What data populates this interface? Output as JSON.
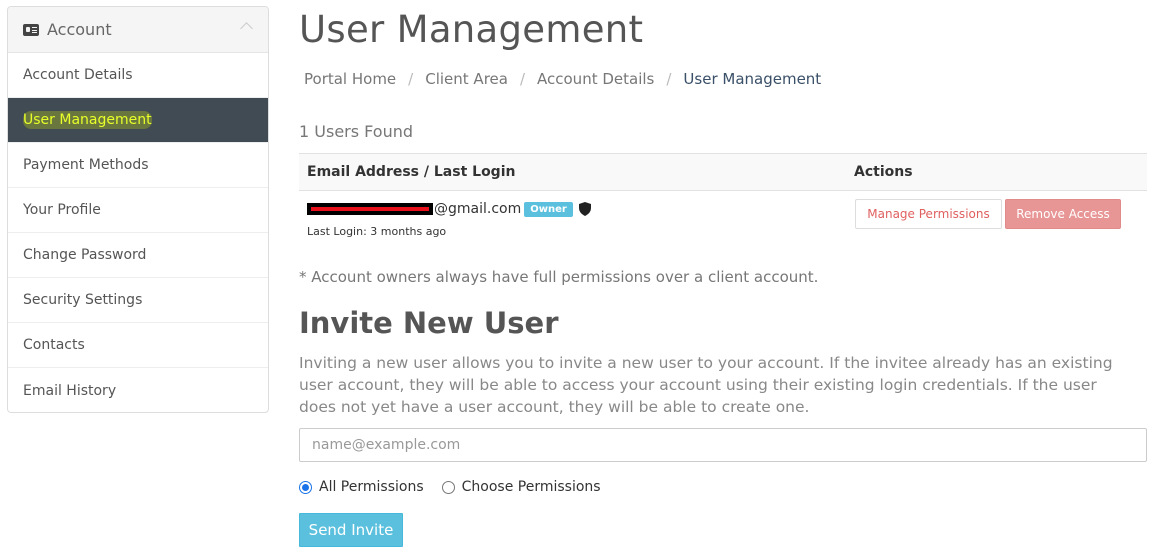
{
  "sidebar": {
    "header": {
      "title": "Account",
      "icon": "id-card-icon"
    },
    "items": [
      {
        "label": "Account Details"
      },
      {
        "label": "User Management"
      },
      {
        "label": "Payment Methods"
      },
      {
        "label": "Your Profile"
      },
      {
        "label": "Change Password"
      },
      {
        "label": "Security Settings"
      },
      {
        "label": "Contacts"
      },
      {
        "label": "Email History"
      }
    ]
  },
  "page": {
    "title": "User Management"
  },
  "breadcrumb": [
    "Portal Home",
    "Client Area",
    "Account Details",
    "User Management"
  ],
  "users": {
    "count_text": "1 Users Found",
    "columns": [
      "Email Address / Last Login",
      "Actions"
    ],
    "rows": [
      {
        "email_suffix": "@gmail.com",
        "badge": "Owner",
        "last_login": "Last Login: 3 months ago",
        "manage_label": "Manage Permissions",
        "remove_label": "Remove Access"
      }
    ],
    "note": "* Account owners always have full permissions over a client account."
  },
  "invite": {
    "title": "Invite New User",
    "description": "Inviting a new user allows you to invite a new user to your account. If the invitee already has an existing user account, they will be able to access your account using their existing login credentials. If the user does not yet have a user account, they will be able to create one.",
    "email_placeholder": "name@example.com",
    "permissions": [
      {
        "label": "All Permissions",
        "checked": true
      },
      {
        "label": "Choose Permissions",
        "checked": false
      }
    ],
    "send_label": "Send Invite"
  },
  "colors": {
    "active_bg": "#414b53",
    "info": "#5bc0de",
    "danger": "#e89595"
  }
}
